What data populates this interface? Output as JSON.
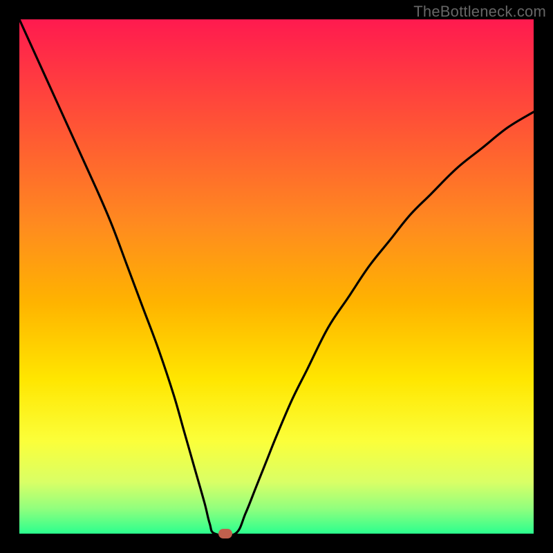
{
  "watermark": "TheBottleneck.com",
  "chart_data": {
    "type": "line",
    "title": "",
    "xlabel": "",
    "ylabel": "",
    "xlim": [
      0,
      100
    ],
    "ylim": [
      0,
      100
    ],
    "grid": false,
    "legend": "none",
    "background": "rainbow-gradient (red→yellow→green, top→bottom)",
    "series": [
      {
        "name": "bottleneck-curve",
        "x": [
          0,
          5,
          10,
          15,
          18,
          21,
          24,
          27,
          30,
          32,
          34,
          36,
          37,
          38,
          42,
          44,
          46,
          48,
          50,
          53,
          56,
          60,
          64,
          68,
          72,
          76,
          80,
          85,
          90,
          95,
          100
        ],
        "values": [
          100,
          89,
          78,
          67,
          60,
          52,
          44,
          36,
          27,
          20,
          13,
          6,
          2,
          0,
          0,
          4,
          9,
          14,
          19,
          26,
          32,
          40,
          46,
          52,
          57,
          62,
          66,
          71,
          75,
          79,
          82
        ]
      }
    ],
    "marker": {
      "x": 40,
      "y": 0,
      "color": "#c0604d",
      "shape": "rounded-rect"
    },
    "gradient_stops": [
      {
        "offset": 0.0,
        "color": "#ff1a4f"
      },
      {
        "offset": 0.2,
        "color": "#ff5236"
      },
      {
        "offset": 0.4,
        "color": "#ff8b1f"
      },
      {
        "offset": 0.55,
        "color": "#ffb300"
      },
      {
        "offset": 0.7,
        "color": "#ffe600"
      },
      {
        "offset": 0.82,
        "color": "#fbff3a"
      },
      {
        "offset": 0.9,
        "color": "#d9ff66"
      },
      {
        "offset": 0.95,
        "color": "#93ff7d"
      },
      {
        "offset": 1.0,
        "color": "#2bff8e"
      }
    ]
  },
  "frame": {
    "outer_color": "#000000",
    "inner_size_px": 744,
    "outer_size_px": 800
  }
}
